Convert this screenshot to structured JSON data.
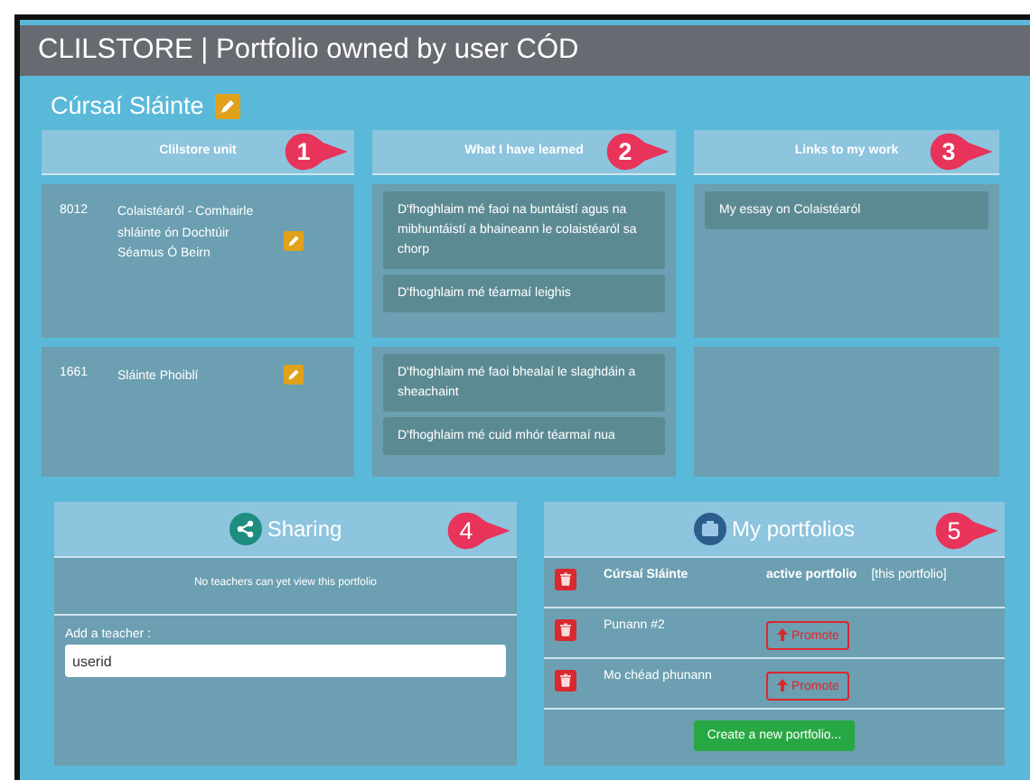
{
  "window": {
    "title": "CLILSTORE | Portfolio owned by user CÓD"
  },
  "portfolio": {
    "name": "Cúrsaí Sláinte"
  },
  "table": {
    "columns": [
      {
        "label": "Clilstore unit",
        "callout": "1"
      },
      {
        "label": "What I have learned",
        "callout": "2"
      },
      {
        "label": "Links to my work",
        "callout": "3"
      }
    ],
    "rows": [
      {
        "unit_id": "8012",
        "unit_name": "Colaistéaról - Comhairle shláinte ón Dochtúir Séamus Ó Beirn",
        "learned": [
          "D'fhoghlaim mé faoi na buntáistí agus na mibhuntáistí a bhaineann le colaistéaról sa chorp",
          "D'fhoghlaim mé téarmaí leighis"
        ],
        "links": [
          "My essay on Colaistéaról"
        ]
      },
      {
        "unit_id": "1661",
        "unit_name": "Sláinte Phoiblí",
        "learned": [
          "D'fhoghlaim mé faoi bhealaí le slaghdáin a sheachaint",
          "D'fhoghlaim mé cuid mhór téarmaí nua"
        ],
        "links": []
      }
    ]
  },
  "sharing": {
    "title": "Sharing",
    "callout": "4",
    "message": "No teachers can yet view this portfolio",
    "field_label": "Add a teacher :",
    "field_value": "userid"
  },
  "my_portfolios": {
    "title": "My portfolios",
    "callout": "5",
    "items": [
      {
        "name": "Cúrsaí Sláinte",
        "active": true,
        "status": "active portfolio",
        "note": "[this portfolio]"
      },
      {
        "name": "Punann #2",
        "active": false,
        "action": "Promote"
      },
      {
        "name": "Mo chéad phunann",
        "active": false,
        "action": "Promote"
      }
    ],
    "create_button": "Create a new portfolio..."
  }
}
